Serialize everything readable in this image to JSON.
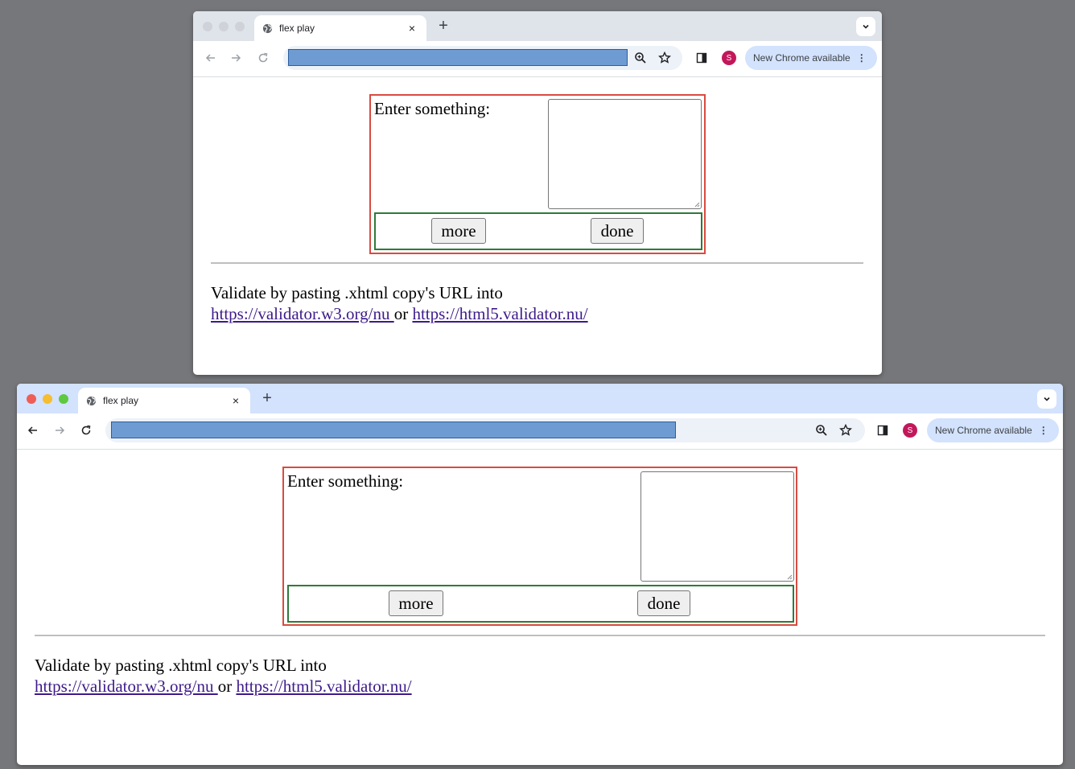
{
  "windows": [
    {
      "tab_title": "flex play",
      "tab_close": "×",
      "new_tab": "+",
      "profile_initial": "S",
      "chrome_update": "New Chrome available",
      "form": {
        "label": "Enter something:",
        "more_button": "more",
        "done_button": "done"
      },
      "validate": {
        "text": "Validate by pasting .xhtml copy's URL into",
        "link1": "https://validator.w3.org/nu ",
        "or": " or ",
        "link2": "https://html5.validator.nu/"
      }
    },
    {
      "tab_title": "flex play",
      "tab_close": "×",
      "new_tab": "+",
      "profile_initial": "S",
      "chrome_update": "New Chrome available",
      "form": {
        "label": "Enter something:",
        "more_button": "more",
        "done_button": "done"
      },
      "validate": {
        "text": "Validate by pasting .xhtml copy's URL into",
        "link1": "https://validator.w3.org/nu ",
        "or": " or ",
        "link2": "https://html5.validator.nu/"
      }
    }
  ],
  "icons": {
    "back": "arrow-left-icon",
    "forward": "arrow-right-icon",
    "reload": "reload-icon",
    "zoom": "zoom-icon",
    "bookmark": "star-icon",
    "side_panel": "side-panel-icon",
    "menu": "kebab-icon",
    "globe": "globe-icon",
    "tab_search": "chevron-down-icon"
  },
  "colors": {
    "form_border": "#d94b40",
    "button_row_border": "#2f7a3b",
    "url_highlight": "#6e9bd1",
    "link": "#3d1a8a"
  }
}
